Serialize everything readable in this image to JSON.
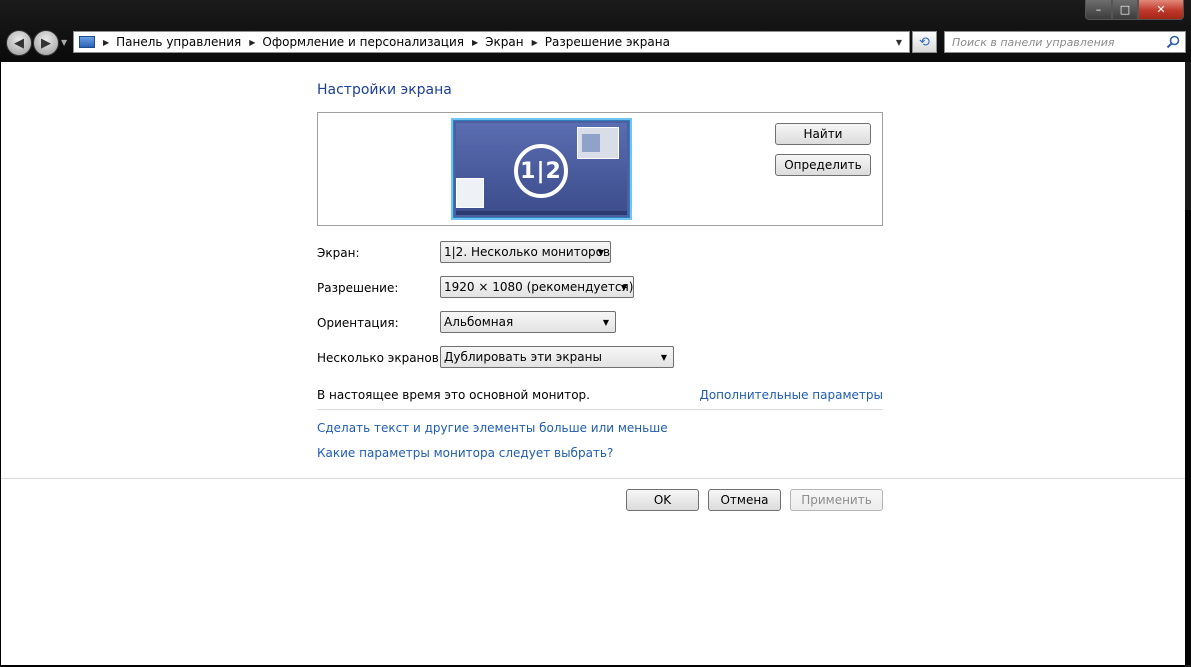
{
  "window": {
    "minimize_glyph": "–",
    "maximize_glyph": "□",
    "close_glyph": "✕"
  },
  "nav": {
    "back_icon": "arrow-left-icon",
    "forward_icon": "arrow-right-icon"
  },
  "address": {
    "breadcrumbs": [
      "Панель управления",
      "Оформление и персонализация",
      "Экран",
      "Разрешение экрана"
    ]
  },
  "search": {
    "placeholder": "Поиск в панели управления"
  },
  "page": {
    "title": "Настройки экрана"
  },
  "preview": {
    "monitor_label": "1|2",
    "find_button": "Найти",
    "identify_button": "Определить"
  },
  "fields": {
    "display_label": "Экран:",
    "display_value": "1|2. Несколько мониторов",
    "resolution_label": "Разрешение:",
    "resolution_value": "1920 × 1080 (рекомендуется)",
    "orientation_label": "Ориентация:",
    "orientation_value": "Альбомная",
    "multiple_label": "Несколько экранов:",
    "multiple_value": "Дублировать эти экраны"
  },
  "info": {
    "primary_note": "В настоящее время это основной монитор.",
    "advanced_link": "Дополнительные параметры",
    "text_size_link": "Сделать текст и другие элементы больше или меньше",
    "monitor_help_link": "Какие параметры монитора следует выбрать?"
  },
  "actions": {
    "ok": "OK",
    "cancel": "Отмена",
    "apply": "Применить"
  },
  "colors": {
    "title_blue": "#1e3f9a",
    "link_blue": "#1e5cb3",
    "monitor_selected_border": "#6fc4f2"
  }
}
